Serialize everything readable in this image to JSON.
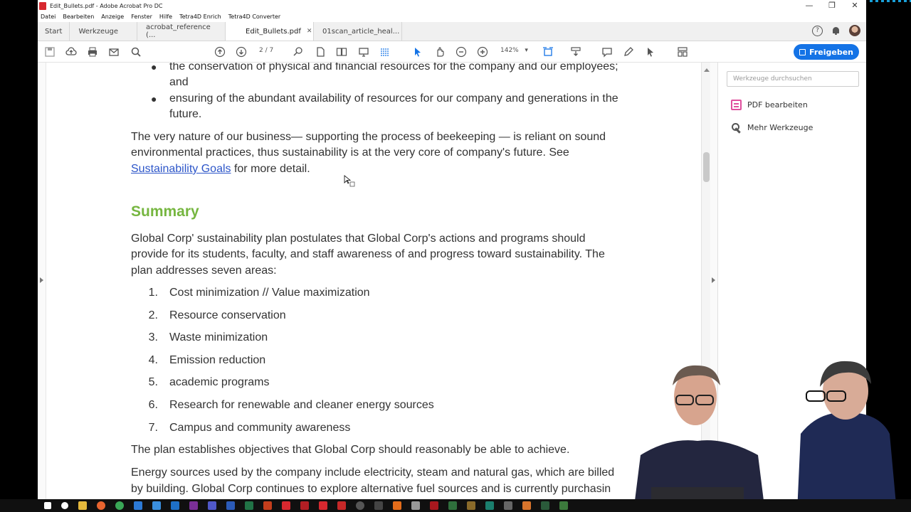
{
  "window": {
    "title": "Edit_Bullets.pdf - Adobe Acrobat Pro DC",
    "controls": [
      "—",
      "❐",
      "✕"
    ]
  },
  "menu": [
    "Datei",
    "Bearbeiten",
    "Anzeige",
    "Fenster",
    "Hilfe",
    "Tetra4D Enrich",
    "Tetra4D Converter"
  ],
  "tabs": {
    "start": "Start",
    "tools": "Werkzeuge",
    "docs": [
      {
        "label": "acrobat_reference (...",
        "active": false
      },
      {
        "label": "Edit_Bullets.pdf",
        "active": true,
        "close": "✕"
      },
      {
        "label": "01scan_article_heal...",
        "active": false
      }
    ]
  },
  "topicons": {
    "help": "?"
  },
  "toolbar": {
    "page_current": "2",
    "page_total": "/ 7",
    "zoom": "142%",
    "zoom_caret": "▾",
    "share_label": "Freigeben"
  },
  "document": {
    "bullets": [
      "the conservation of physical and financial resources for the company and our employees;",
      "and",
      "ensuring of the abundant availability of resources for our company and generations in the",
      "future."
    ],
    "para1_line1": "The very nature of our business— supporting the process of beekeeping — is reliant on sound",
    "para1_line2": "environmental practices, thus sustainability is at the very core of company's future. See",
    "para1_link": "Sustainability Goals",
    "para1_tail": " for more detail.",
    "heading": "Summary",
    "summary_lines": [
      "Global Corp' sustainability plan postulates that Global Corp's actions and programs should",
      "provide for its students, faculty, and staff awareness of and progress toward sustainability. The",
      "plan addresses seven areas:"
    ],
    "list": [
      {
        "n": "1.",
        "t": "Cost minimization // Value maximization"
      },
      {
        "n": "2.",
        "t": "Resource conservation"
      },
      {
        "n": "3.",
        "t": "Waste minimization"
      },
      {
        "n": "4.",
        "t": "Emission reduction"
      },
      {
        "n": "5.",
        "t": "academic programs"
      },
      {
        "n": "6.",
        "t": "Research for renewable and cleaner energy sources"
      },
      {
        "n": "7.",
        "t": "Campus and community awareness"
      }
    ],
    "closing1": "The plan establishes objectives that Global Corp should reasonably be able to achieve.",
    "closing2_line1": "Energy sources used by the company include electricity, steam and natural gas, which are billed",
    "closing2_line2": "by building. Global Corp continues to explore alternative fuel sources and is currently purchasin"
  },
  "rightpane": {
    "search_placeholder": "Werkzeuge durchsuchen",
    "tools": [
      "PDF bearbeiten",
      "Mehr Werkzeuge"
    ]
  },
  "colors": {
    "heading": "#76b640",
    "link": "#2d56c9",
    "share": "#1473e6"
  },
  "icons": [
    "save-icon",
    "upload-icon",
    "print-icon",
    "mail-icon",
    "search-icon",
    "page-up-icon",
    "page-down-icon",
    "select-icon",
    "hand-icon",
    "zoom-out-icon",
    "zoom-in-icon",
    "comment-icon",
    "pen-icon"
  ]
}
